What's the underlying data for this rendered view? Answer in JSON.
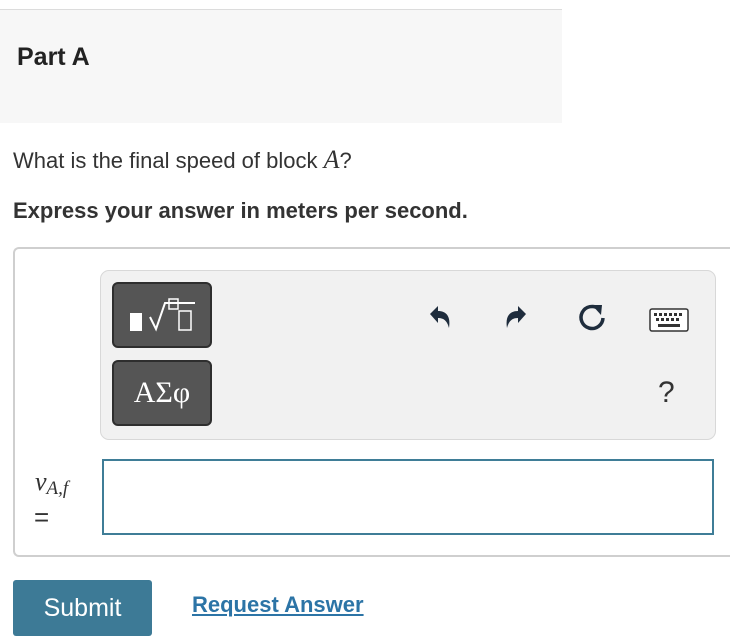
{
  "part": {
    "title": "Part A"
  },
  "question": {
    "prefix": "What is the final speed of block ",
    "variable": "A",
    "suffix": "?"
  },
  "instruction": "Express your answer in meters per second.",
  "toolbar": {
    "symbols_label": "ΑΣφ",
    "help_label": "?",
    "icons": [
      "templates-icon",
      "undo-icon",
      "redo-icon",
      "reset-icon",
      "keyboard-icon"
    ]
  },
  "answer": {
    "variable": "v",
    "subscript": "A,f",
    "equals": "=",
    "value": ""
  },
  "actions": {
    "submit_label": "Submit",
    "request_label": "Request Answer"
  },
  "colors": {
    "accent": "#3d7a96",
    "link": "#2c74a6",
    "tool_button": "#555555"
  }
}
